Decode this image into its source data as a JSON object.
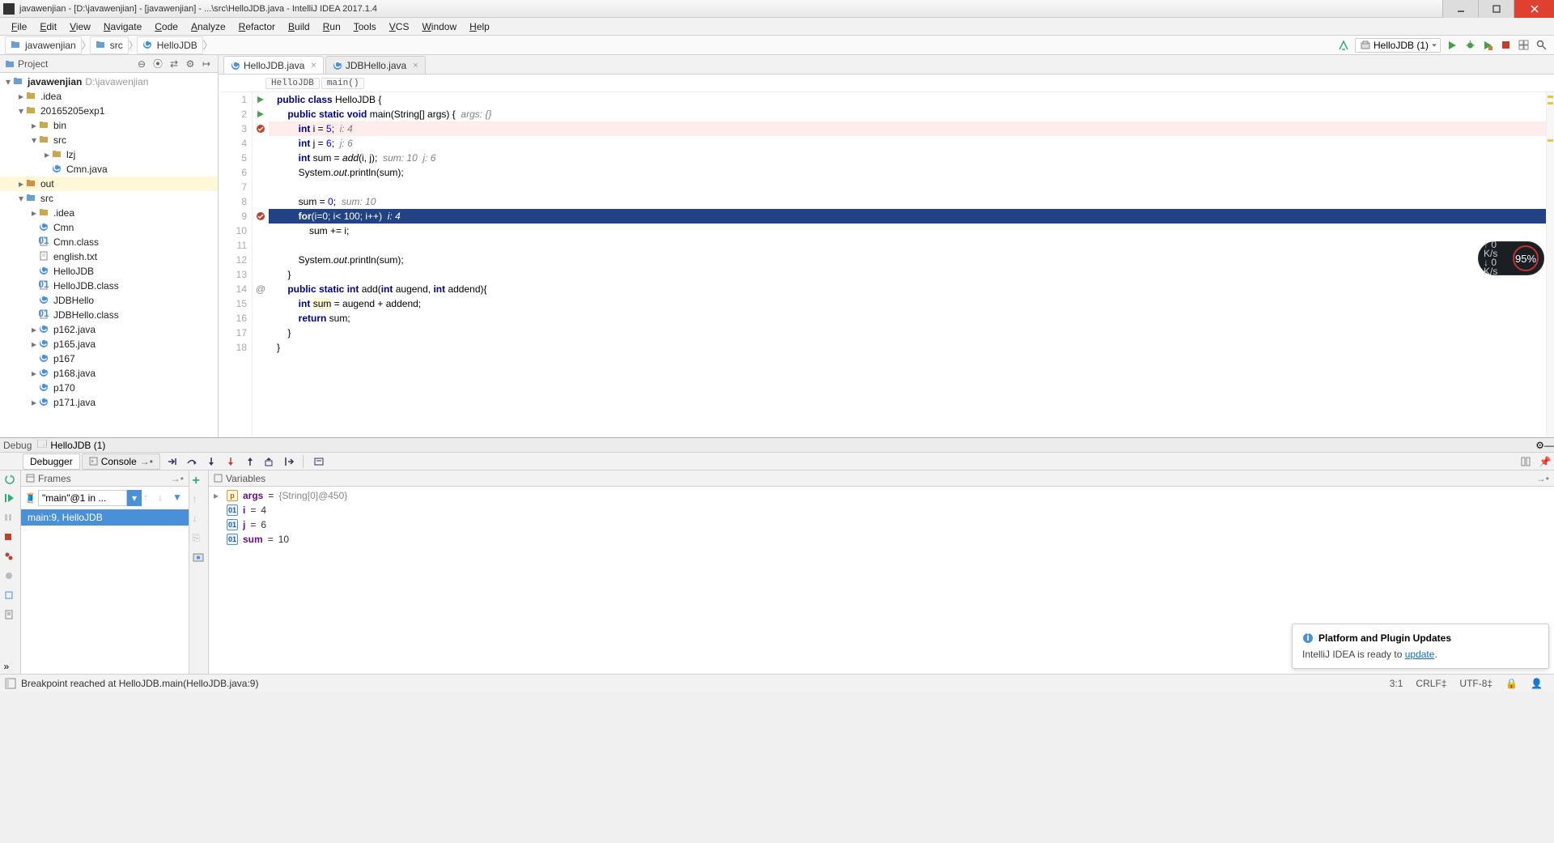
{
  "title": "javawenjian - [D:\\javawenjian] - [javawenjian] - ...\\src\\HelloJDB.java - IntelliJ IDEA 2017.1.4",
  "menu": [
    "File",
    "Edit",
    "View",
    "Navigate",
    "Code",
    "Analyze",
    "Refactor",
    "Build",
    "Run",
    "Tools",
    "VCS",
    "Window",
    "Help"
  ],
  "breadcrumbs": [
    {
      "icon": "folder-blue",
      "label": "javawenjian"
    },
    {
      "icon": "folder-blue",
      "label": "src"
    },
    {
      "icon": "class",
      "label": "HelloJDB"
    }
  ],
  "run_config_label": "HelloJDB (1)",
  "project_panel_title": "Project",
  "tree": [
    {
      "d": 0,
      "a": "down",
      "icon": "folder-blue",
      "label": "javawenjian",
      "path": "D:\\javawenjian"
    },
    {
      "d": 1,
      "a": "right",
      "icon": "folder",
      "label": ".idea"
    },
    {
      "d": 1,
      "a": "down",
      "icon": "folder",
      "label": "20165205exp1"
    },
    {
      "d": 2,
      "a": "right",
      "icon": "folder",
      "label": "bin"
    },
    {
      "d": 2,
      "a": "down",
      "icon": "folder",
      "label": "src"
    },
    {
      "d": 3,
      "a": "right",
      "icon": "folder",
      "label": "lzj"
    },
    {
      "d": 3,
      "a": "none",
      "icon": "class",
      "label": "Cmn.java"
    },
    {
      "d": 1,
      "a": "right",
      "icon": "folder-orange",
      "label": "out",
      "sel": true
    },
    {
      "d": 1,
      "a": "down",
      "icon": "folder-blue",
      "label": "src"
    },
    {
      "d": 2,
      "a": "right",
      "icon": "folder",
      "label": ".idea"
    },
    {
      "d": 2,
      "a": "none",
      "icon": "class",
      "label": "Cmn"
    },
    {
      "d": 2,
      "a": "none",
      "icon": "file-class",
      "label": "Cmn.class"
    },
    {
      "d": 2,
      "a": "none",
      "icon": "file",
      "label": "english.txt"
    },
    {
      "d": 2,
      "a": "none",
      "icon": "class",
      "label": "HelloJDB"
    },
    {
      "d": 2,
      "a": "none",
      "icon": "file-class",
      "label": "HelloJDB.class"
    },
    {
      "d": 2,
      "a": "none",
      "icon": "class",
      "label": "JDBHello"
    },
    {
      "d": 2,
      "a": "none",
      "icon": "file-class",
      "label": "JDBHello.class"
    },
    {
      "d": 2,
      "a": "right",
      "icon": "class",
      "label": "p162.java"
    },
    {
      "d": 2,
      "a": "right",
      "icon": "class",
      "label": "p165.java"
    },
    {
      "d": 2,
      "a": "none",
      "icon": "class",
      "label": "p167"
    },
    {
      "d": 2,
      "a": "right",
      "icon": "class",
      "label": "p168.java"
    },
    {
      "d": 2,
      "a": "none",
      "icon": "class",
      "label": "p170"
    },
    {
      "d": 2,
      "a": "right",
      "icon": "class",
      "label": "p171.java"
    }
  ],
  "editor_tabs": [
    {
      "icon": "class",
      "label": "HelloJDB.java",
      "active": true
    },
    {
      "icon": "class",
      "label": "JDBHello.java",
      "active": false
    }
  ],
  "editor_breadcrumb": [
    "HelloJDB",
    "main()"
  ],
  "code_lines": [
    {
      "n": 1,
      "g": "run",
      "html": "<span class='kw'>public class</span> HelloJDB {"
    },
    {
      "n": 2,
      "g": "run",
      "html": "    <span class='kw'>public static void</span> main(String[] args) {  <span class='cm'>args: {}</span>"
    },
    {
      "n": 3,
      "g": "bp",
      "cls": "err",
      "html": "        <span class='kw'>int</span> i = <span class='num'>5</span>;  <span class='cm'>i: 4</span>"
    },
    {
      "n": 4,
      "html": "        <span class='kw'>int</span> j = <span class='num'>6</span>;  <span class='cm'>j: 6</span>"
    },
    {
      "n": 5,
      "html": "        <span class='kw'>int</span> sum = <span class='fn'>add</span>(i, j);  <span class='cm'>sum: 10  j: 6</span>"
    },
    {
      "n": 6,
      "html": "        System.<span class='fn'>out</span>.println(sum);"
    },
    {
      "n": 7,
      "html": ""
    },
    {
      "n": 8,
      "html": "        sum = <span class='num'>0</span>;  <span class='cm'>sum: 10</span>"
    },
    {
      "n": 9,
      "g": "bp",
      "cls": "brk",
      "html": "        <span class='kw'>for</span>(i=0; i&lt; 100; i++)  <span class='cm'>i: 4</span>"
    },
    {
      "n": 10,
      "html": "            sum += i;"
    },
    {
      "n": 11,
      "html": ""
    },
    {
      "n": 12,
      "html": "        System.<span class='fn'>out</span>.println(sum);"
    },
    {
      "n": 13,
      "html": "    }"
    },
    {
      "n": 14,
      "g": "ov",
      "html": "    <span class='kw'>public static int</span> add(<span class='kw'>int</span> augend, <span class='kw'>int</span> addend){"
    },
    {
      "n": 15,
      "html": "        <span class='kw'>int</span> <span style='background:#fff7d0'>sum</span> = augend + addend;"
    },
    {
      "n": 16,
      "html": "        <span class='kw'>return</span> sum;"
    },
    {
      "n": 17,
      "html": "    }"
    },
    {
      "n": 18,
      "html": "}"
    }
  ],
  "debug_tab_label": "Debug",
  "debug_config_label": "HelloJDB (1)",
  "debugger_tab": "Debugger",
  "console_tab": "Console",
  "frames_title": "Frames",
  "variables_title": "Variables",
  "frame_dropdown_text": "\"main\"@1 in ...",
  "frame_item": "main:9, HelloJDB",
  "variables": [
    {
      "icon": "p",
      "name": "args",
      "val": "{String[0]@450}",
      "obj": true,
      "chev": true
    },
    {
      "icon": "n",
      "name": "i",
      "val": "4"
    },
    {
      "icon": "n",
      "name": "j",
      "val": "6"
    },
    {
      "icon": "n",
      "name": "sum",
      "val": "10"
    }
  ],
  "notification": {
    "title": "Platform and Plugin Updates",
    "body_pre": "IntelliJ IDEA is ready to ",
    "link": "update",
    "body_post": "."
  },
  "status_msg": "Breakpoint reached at HelloJDB.main(HelloJDB.java:9)",
  "status_right": [
    "3:1",
    "CRLF‡",
    "UTF-8‡"
  ],
  "perf": {
    "up": "0 K/s",
    "down": "0 K/s",
    "pct": "95%"
  }
}
